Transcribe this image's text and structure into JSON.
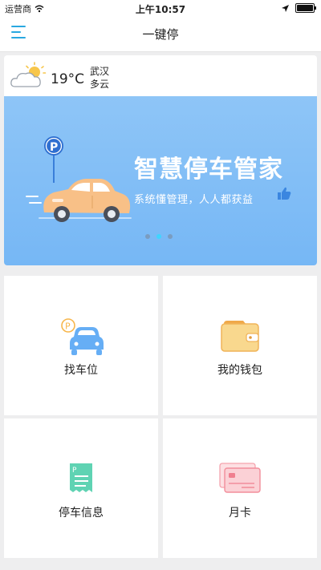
{
  "status_bar": {
    "carrier": "运营商",
    "time": "上午10:57"
  },
  "nav": {
    "title": "一键停",
    "menu_icon": "menu-icon"
  },
  "weather": {
    "temperature": "19°C",
    "city": "武汉",
    "condition": "多云",
    "icon": "partly-cloudy-icon"
  },
  "banner": {
    "slogan": "智慧停车管家",
    "subtitle": "系统懂管理，人人都获益",
    "dots_total": 3,
    "dots_active": 2
  },
  "tiles": [
    {
      "label": "找车位",
      "icon": "find-parking-icon"
    },
    {
      "label": "我的钱包",
      "icon": "wallet-icon"
    },
    {
      "label": "停车信息",
      "icon": "parking-info-icon"
    },
    {
      "label": "月卡",
      "icon": "monthly-card-icon"
    }
  ],
  "colors": {
    "accent": "#29a8e0",
    "banner": "#7fbdf6",
    "car": "#f8c087",
    "background": "#eeeeef"
  }
}
